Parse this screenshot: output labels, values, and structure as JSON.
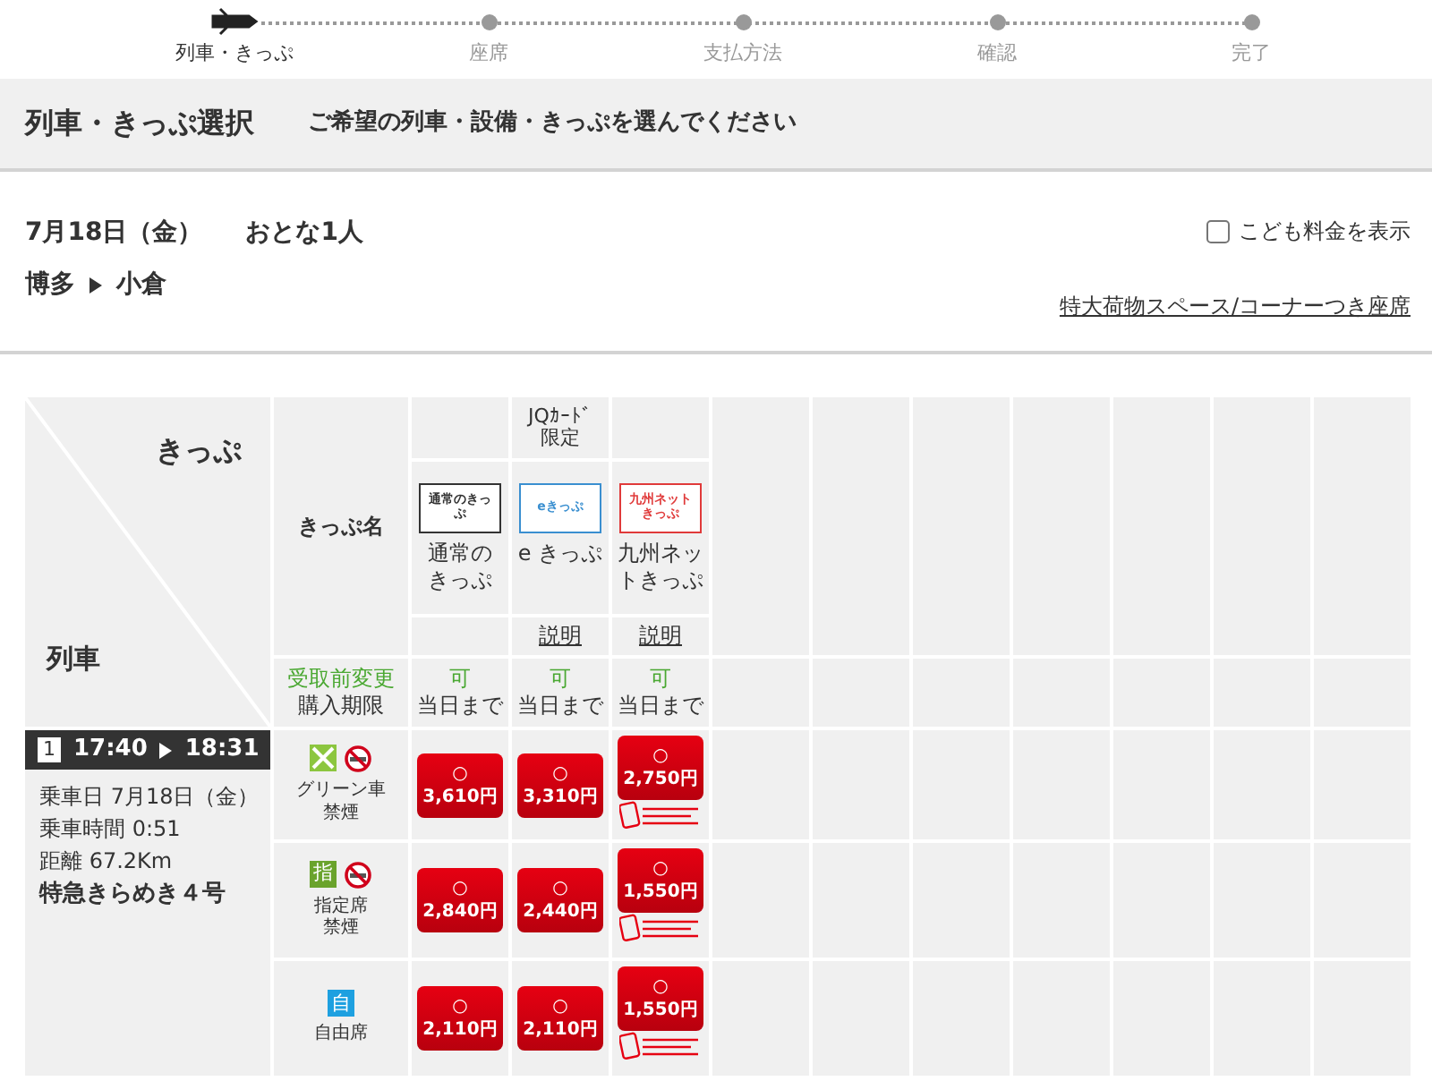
{
  "steps": [
    {
      "label": "列車・きっぷ",
      "selected": true
    },
    {
      "label": "座席",
      "selected": false
    },
    {
      "label": "支払方法",
      "selected": false
    },
    {
      "label": "確認",
      "selected": false
    },
    {
      "label": "完了",
      "selected": false
    }
  ],
  "header": {
    "title": "列車・きっぷ選択",
    "subtitle": "ご希望の列車・設備・きっぷを選んでください"
  },
  "search_info": {
    "date": "7月18日（金）",
    "passengers": "おとな1人",
    "from": "博多",
    "to": "小倉",
    "child_fare": {
      "label": "こども料金を表示",
      "checked": false
    },
    "link": "特大荷物スペース/コーナーつき座席"
  },
  "table": {
    "corner_top": "きっぷ",
    "corner_bottom": "列車",
    "name_label": "きっぷ名",
    "change_label": "受取前変更",
    "deadline_label": "購入期限",
    "tickets": [
      {
        "logo": "通常のきっぷ",
        "color": "#333333",
        "name_lines": [
          "通常の",
          "きっぷ"
        ],
        "change": "可",
        "deadline": "当日まで"
      },
      {
        "note_lines": [
          "JQｶｰﾄﾞ",
          "限定"
        ],
        "logo": "eきっぷ",
        "color": "#3a8fd0",
        "name_lines": [
          "e きっぷ"
        ],
        "info_link": "説明",
        "change": "可",
        "deadline": "当日まで"
      },
      {
        "logo": "九州ネットきっぷ",
        "color": "#e03a3a",
        "name_lines": [
          "九州ネッ",
          "トきっぷ"
        ],
        "info_link": "説明",
        "change": "可",
        "deadline": "当日まで"
      }
    ],
    "train": {
      "number": "1",
      "depart": "17:40",
      "arrive": "18:31",
      "details": [
        "乗車日 7月18日（金）",
        "乗車時間 0:51",
        "距離 67.2Km"
      ],
      "name": "特急きらめき４号"
    },
    "seats": [
      {
        "kind": "green",
        "non_smoking": true,
        "label_lines": [
          "グリーン車",
          "禁煙"
        ],
        "fares": [
          {
            "mark": "○",
            "price": "3,610円",
            "qr": false
          },
          {
            "mark": "○",
            "price": "3,310円",
            "qr": false
          },
          {
            "mark": "○",
            "price": "2,750円",
            "qr": true
          }
        ]
      },
      {
        "kind": "reserved",
        "badge": "指",
        "non_smoking": true,
        "label_lines": [
          "指定席",
          "禁煙"
        ],
        "fares": [
          {
            "mark": "○",
            "price": "2,840円",
            "qr": false
          },
          {
            "mark": "○",
            "price": "2,440円",
            "qr": false
          },
          {
            "mark": "○",
            "price": "1,550円",
            "qr": true
          }
        ]
      },
      {
        "kind": "unreserved",
        "badge": "自",
        "non_smoking": false,
        "label_lines": [
          "自由席"
        ],
        "fares": [
          {
            "mark": "○",
            "price": "2,110円",
            "qr": false
          },
          {
            "mark": "○",
            "price": "2,110円",
            "qr": false
          },
          {
            "mark": "○",
            "price": "1,550円",
            "qr": true
          }
        ]
      }
    ]
  }
}
